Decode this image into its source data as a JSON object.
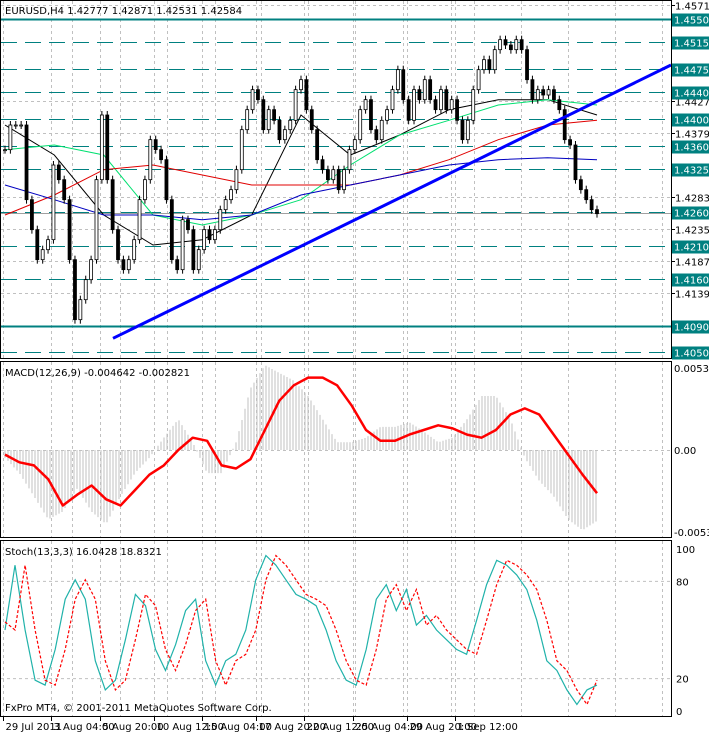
{
  "header": {
    "symbol_label": "EURUSD,H4  1.42777 1.42871 1.42531 1.42584"
  },
  "footer": {
    "copyright": "FxPro MT4, © 2001-2011 MetaQuotes Software Corp."
  },
  "colors": {
    "background": "#ffffff",
    "level": "#008080",
    "trendline": "#0000ff",
    "macd_signal": "#ff0000",
    "histogram": "#c0c0c0",
    "stoch_main": "#20b2aa",
    "stoch_signal": "#ff0000",
    "ma_black": "#000000",
    "ma_green": "#00e070",
    "ma_red": "#e00000",
    "ma_blue": "#0000c0"
  },
  "chart_data": [
    {
      "type": "candlestick",
      "title": "EURUSD,H4  1.42777 1.42871 1.42531 1.42584",
      "ylim": [
        1.405,
        1.4571
      ],
      "y_ticks": [
        "1.45710",
        "1.44270",
        "1.43790",
        "1.42830",
        "1.42350",
        "1.41870",
        "1.41390"
      ],
      "x_tick_labels": [
        "29 Jul 2011",
        "3 Aug 04:00",
        "5 Aug 20:00",
        "10 Aug 12:00",
        "15 Aug 04:00",
        "17 Aug 20:00",
        "22 Aug 12:00",
        "25 Aug 04:00",
        "29 Aug 20:00",
        "1 Sep 12:00"
      ],
      "closes": [
        1.4354,
        1.4391,
        1.4391,
        1.4391,
        1.4279,
        1.4234,
        1.4189,
        1.4204,
        1.4219,
        1.4331,
        1.4309,
        1.4279,
        1.4189,
        1.4099,
        1.4129,
        1.4159,
        1.4189,
        1.4309,
        1.4406,
        1.4309,
        1.4234,
        1.4189,
        1.4174,
        1.4189,
        1.4219,
        1.4279,
        1.4309,
        1.4369,
        1.4354,
        1.4339,
        1.4279,
        1.4189,
        1.4174,
        1.4249,
        1.4234,
        1.4174,
        1.4204,
        1.4234,
        1.4219,
        1.4234,
        1.4264,
        1.4279,
        1.4294,
        1.4324,
        1.4384,
        1.4414,
        1.4444,
        1.4429,
        1.4384,
        1.4414,
        1.4398,
        1.4369,
        1.4384,
        1.4398,
        1.4444,
        1.4459,
        1.4414,
        1.4384,
        1.4339,
        1.4324,
        1.4309,
        1.4324,
        1.4294,
        1.4324,
        1.4354,
        1.4369,
        1.4414,
        1.4429,
        1.4384,
        1.4369,
        1.4398,
        1.4414,
        1.4444,
        1.4474,
        1.4429,
        1.4398,
        1.4444,
        1.4429,
        1.4459,
        1.4429,
        1.4414,
        1.4444,
        1.4414,
        1.4429,
        1.4398,
        1.4369,
        1.4398,
        1.4444,
        1.4474,
        1.4489,
        1.4474,
        1.4504,
        1.4519,
        1.4511,
        1.4504,
        1.4519,
        1.4504,
        1.4459,
        1.4429,
        1.4444,
        1.4436,
        1.4444,
        1.4429,
        1.4414,
        1.4369,
        1.4361,
        1.4309,
        1.4294,
        1.4279,
        1.4264,
        1.4258
      ],
      "moving_averages": [
        {
          "color": "#000000",
          "values": [
            1.4391,
            1.4346,
            1.4256,
            1.4211,
            1.4219,
            1.4256,
            1.4406,
            1.4346,
            1.4376,
            1.4414,
            1.4429,
            1.4429,
            1.4406
          ]
        },
        {
          "color": "#00e070",
          "values": [
            1.4354,
            1.4361,
            1.4346,
            1.4256,
            1.4241,
            1.4256,
            1.4279,
            1.4331,
            1.4376,
            1.4398,
            1.4421,
            1.4429,
            1.4421
          ]
        },
        {
          "color": "#e00000",
          "values": [
            1.4256,
            1.4286,
            1.4324,
            1.4331,
            1.4316,
            1.4301,
            1.4301,
            1.4301,
            1.4316,
            1.4339,
            1.4369,
            1.4391,
            1.4398
          ]
        },
        {
          "color": "#0000c0",
          "values": [
            1.4301,
            1.4279,
            1.4256,
            1.4256,
            1.4249,
            1.4256,
            1.4286,
            1.4301,
            1.4316,
            1.4331,
            1.4339,
            1.4342,
            1.4339
          ]
        }
      ],
      "trendline": {
        "from_price": 1.4071,
        "to_price": 1.4481
      },
      "levels": [
        {
          "price": 1.455,
          "label": "1.45500",
          "style": "solid"
        },
        {
          "price": 1.4515,
          "label": "1.45150",
          "style": "dashed"
        },
        {
          "price": 1.4475,
          "label": "1.44750",
          "style": "dashed"
        },
        {
          "price": 1.444,
          "label": "1.44400",
          "style": "dashed"
        },
        {
          "price": 1.44,
          "label": "1.44000",
          "style": "dashed"
        },
        {
          "price": 1.436,
          "label": "1.43600",
          "style": "dashed"
        },
        {
          "price": 1.4325,
          "label": "1.43250",
          "style": "dashed"
        },
        {
          "price": 1.426,
          "label": "1.42600",
          "style": "dashed"
        },
        {
          "price": 1.421,
          "label": "1.42100",
          "style": "dashed"
        },
        {
          "price": 1.416,
          "label": "1.41600",
          "style": "dashed"
        },
        {
          "price": 1.409,
          "label": "1.40900",
          "style": "solid"
        },
        {
          "price": 1.405,
          "label": "1.40500",
          "style": "dashed"
        }
      ]
    },
    {
      "type": "bar+line",
      "title": "MACD(12,26,9) -0.004642 -0.002821",
      "ylim": [
        -0.00532,
        0.00532
      ],
      "y_ticks": [
        "0.00532",
        "0.00",
        "-0.00532"
      ],
      "histogram": [
        -0.0005,
        -0.0015,
        -0.003,
        -0.0045,
        -0.004,
        -0.0025,
        -0.004,
        -0.0048,
        -0.003,
        -0.0015,
        -0.0005,
        0.0008,
        0.002,
        0.0005,
        -0.0015,
        -0.0015,
        0.0005,
        0.004,
        0.0055,
        0.005,
        0.0045,
        0.0035,
        0.002,
        0.0005,
        0.0005,
        0.0008,
        0.0015,
        0.0015,
        0.0018,
        0.0012,
        0.0005,
        0.0008,
        0.002,
        0.0035,
        0.0035,
        0.002,
        -0.0005,
        -0.002,
        -0.003,
        -0.0045,
        -0.0052,
        -0.0046
      ],
      "signal": [
        -0.0003,
        -0.0008,
        -0.001,
        -0.0019,
        -0.0036,
        -0.0029,
        -0.0023,
        -0.0032,
        -0.0036,
        -0.0026,
        -0.0016,
        -0.001,
        0,
        0.0008,
        0.0006,
        -0.001,
        -0.0012,
        -0.0006,
        0.0013,
        0.0032,
        0.0042,
        0.0047,
        0.0047,
        0.0042,
        0.0029,
        0.0013,
        0.0006,
        0.0006,
        0.001,
        0.0013,
        0.0016,
        0.0014,
        0.001,
        0.0008,
        0.0013,
        0.0023,
        0.0027,
        0.0023,
        0.001,
        -0.0003,
        -0.0016,
        -0.0028
      ]
    },
    {
      "type": "line",
      "title": "Stoch(13,3,3) 16.0428 18.8321",
      "ylim": [
        0,
        100
      ],
      "y_ticks": [
        "100",
        "80",
        "20",
        "0"
      ],
      "main": [
        50,
        90,
        50,
        19,
        16,
        38,
        69,
        81,
        69,
        31,
        13,
        19,
        44,
        72,
        65,
        38,
        25,
        41,
        62,
        69,
        31,
        16,
        31,
        35,
        50,
        81,
        96,
        90,
        81,
        72,
        69,
        65,
        50,
        31,
        19,
        16,
        38,
        69,
        78,
        62,
        75,
        53,
        59,
        50,
        44,
        38,
        35,
        56,
        78,
        93,
        90,
        84,
        75,
        56,
        31,
        25,
        13,
        4,
        13,
        16
      ],
      "signal": [
        55,
        50,
        90,
        50,
        19,
        16,
        38,
        69,
        81,
        69,
        31,
        13,
        19,
        44,
        72,
        65,
        38,
        25,
        41,
        62,
        69,
        31,
        16,
        31,
        35,
        50,
        81,
        96,
        90,
        81,
        72,
        69,
        65,
        50,
        31,
        19,
        16,
        38,
        69,
        78,
        62,
        75,
        53,
        59,
        50,
        44,
        38,
        35,
        56,
        78,
        93,
        90,
        84,
        75,
        56,
        31,
        25,
        13,
        4,
        19
      ]
    }
  ]
}
